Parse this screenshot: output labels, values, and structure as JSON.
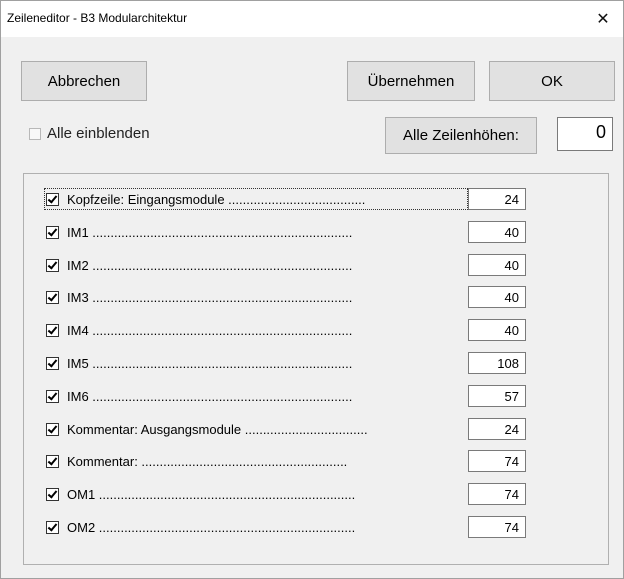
{
  "window": {
    "title": "Zeileneditor - B3 Modularchitektur"
  },
  "toolbar": {
    "cancel_label": "Abbrechen",
    "apply_label": "Übernehmen",
    "ok_label": "OK"
  },
  "options": {
    "show_all_label": "Alle einblenden",
    "show_all_checked": false,
    "all_heights_label": "Alle Zeilenhöhen:",
    "all_heights_value": "0"
  },
  "rows": [
    {
      "label": "Kopfzeile: Eingangsmodule ......................................",
      "checked": true,
      "height": "24"
    },
    {
      "label": "IM1 ........................................................................",
      "checked": true,
      "height": "40"
    },
    {
      "label": "IM2 ........................................................................",
      "checked": true,
      "height": "40"
    },
    {
      "label": "IM3 ........................................................................",
      "checked": true,
      "height": "40"
    },
    {
      "label": "IM4 ........................................................................",
      "checked": true,
      "height": "40"
    },
    {
      "label": "IM5 ........................................................................",
      "checked": true,
      "height": "108"
    },
    {
      "label": "IM6 ........................................................................",
      "checked": true,
      "height": "57"
    },
    {
      "label": "Kommentar: Ausgangsmodule ..................................",
      "checked": true,
      "height": "24"
    },
    {
      "label": "Kommentar: .........................................................",
      "checked": true,
      "height": "74"
    },
    {
      "label": "OM1 .......................................................................",
      "checked": true,
      "height": "74"
    },
    {
      "label": "OM2 .......................................................................",
      "checked": true,
      "height": "74"
    }
  ]
}
